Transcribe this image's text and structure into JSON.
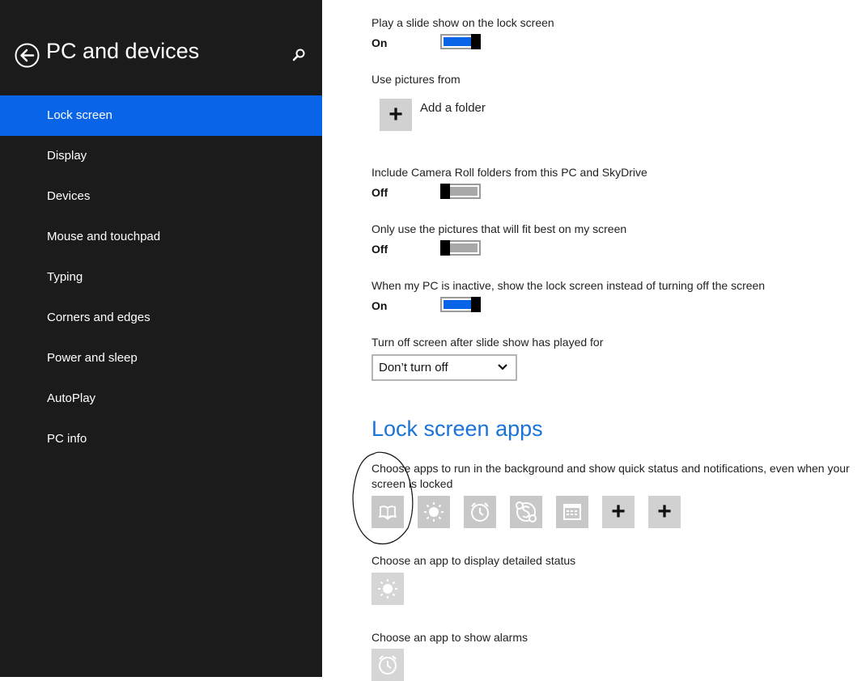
{
  "app": {
    "title": "PC and devices"
  },
  "sidebar": {
    "items": [
      {
        "label": "Lock screen",
        "selected": true
      },
      {
        "label": "Display"
      },
      {
        "label": "Devices"
      },
      {
        "label": "Mouse and touchpad"
      },
      {
        "label": "Typing"
      },
      {
        "label": "Corners and edges"
      },
      {
        "label": "Power and sleep"
      },
      {
        "label": "AutoPlay"
      },
      {
        "label": "PC info"
      }
    ]
  },
  "settings": {
    "slideshow": {
      "label": "Play a slide show on the lock screen",
      "state": "On"
    },
    "pictures_from": {
      "label": "Use pictures from",
      "add_folder": "Add a folder"
    },
    "camera_roll": {
      "label": "Include Camera Roll folders from this PC and SkyDrive",
      "state": "Off"
    },
    "fit_best": {
      "label": "Only use the pictures that will fit best on my screen",
      "state": "Off"
    },
    "inactive": {
      "label": "When my PC is inactive, show the lock screen instead of turning off the screen",
      "state": "On"
    },
    "turn_off": {
      "label": "Turn off screen after slide show has played for",
      "value": "Don’t turn off"
    }
  },
  "lock_apps": {
    "title": "Lock screen apps",
    "description": "Choose apps to run in the background and show quick status and notifications, even when your screen is locked",
    "apps": [
      "reader-icon",
      "weather-icon",
      "alarms-icon",
      "skype-icon",
      "calendar-icon",
      "add-icon",
      "add-icon"
    ],
    "detailed_status_label": "Choose an app to display detailed status",
    "detailed_status_app": "weather-icon",
    "alarms_label": "Choose an app to show alarms",
    "alarms_app": "alarms-icon"
  },
  "colors": {
    "accent": "#0a64e8",
    "sidebar_bg": "#1b1b1b",
    "heading": "#1a73d9"
  }
}
